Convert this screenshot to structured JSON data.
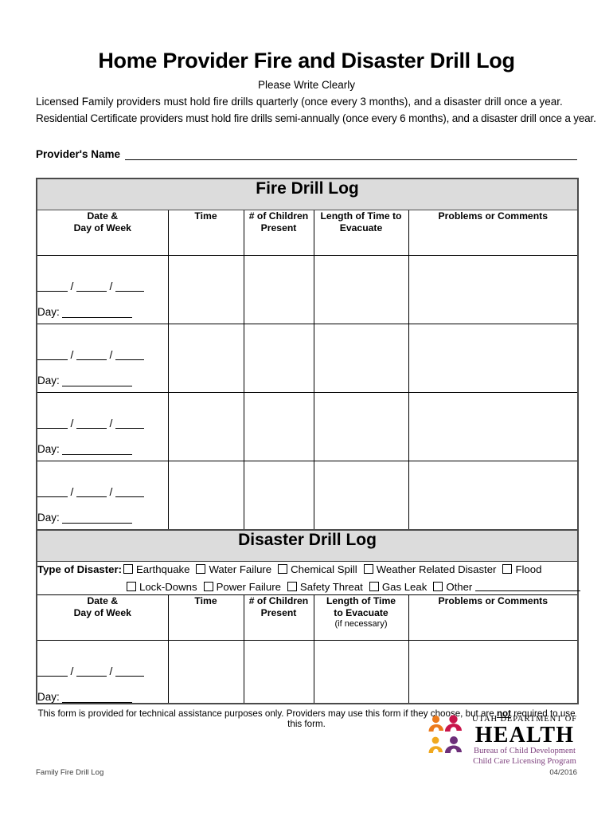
{
  "document": {
    "title": "Home Provider Fire and Disaster Drill Log",
    "subtitle": "Please Write Clearly",
    "intro_line_1": "Licensed Family providers must hold fire drills quarterly (once every 3 months), and a disaster drill once a year.",
    "intro_line_2": "Residential Certificate providers must hold fire drills semi-annually (once every 6 months), and a disaster drill once a year."
  },
  "provider": {
    "label": "Provider's Name",
    "value": ""
  },
  "fire_drill_log": {
    "band_title": "Fire Drill Log",
    "columns": [
      {
        "line1": "Date &",
        "line2": "Day of Week"
      },
      {
        "line1": "Time",
        "line2": ""
      },
      {
        "line1": "# of Children",
        "line2": "Present"
      },
      {
        "line1": "Length of Time to",
        "line2": "Evacuate"
      },
      {
        "line1": "Problems or Comments",
        "line2": ""
      }
    ],
    "day_label": "Day:",
    "date_separator": "/",
    "row_count": 4,
    "rows": [
      {
        "date": "",
        "day": "",
        "time": "",
        "children": "",
        "length": "",
        "comments": ""
      },
      {
        "date": "",
        "day": "",
        "time": "",
        "children": "",
        "length": "",
        "comments": ""
      },
      {
        "date": "",
        "day": "",
        "time": "",
        "children": "",
        "length": "",
        "comments": ""
      },
      {
        "date": "",
        "day": "",
        "time": "",
        "children": "",
        "length": "",
        "comments": ""
      }
    ]
  },
  "disaster_drill_log": {
    "band_title": "Disaster Drill Log",
    "type_label": "Type of Disaster:",
    "type_options_row1": [
      "Earthquake",
      "Water Failure",
      "Chemical Spill",
      "Weather Related Disaster",
      "Flood"
    ],
    "type_options_row2": [
      "Lock-Downs",
      "Power Failure",
      "Safety Threat",
      "Gas Leak",
      "Other"
    ],
    "other_value": "",
    "columns": [
      {
        "line1": "Date &",
        "line2": "Day of Week",
        "note": ""
      },
      {
        "line1": "Time",
        "line2": "",
        "note": ""
      },
      {
        "line1": "# of Children",
        "line2": "Present",
        "note": ""
      },
      {
        "line1": "Length of Time",
        "line2": "to Evacuate",
        "note": "(if necessary)"
      },
      {
        "line1": "Problems or Comments",
        "line2": "",
        "note": ""
      }
    ],
    "day_label": "Day:",
    "date_separator": "/",
    "row_count": 1,
    "rows": [
      {
        "date": "",
        "day": "",
        "time": "",
        "children": "",
        "length": "",
        "comments": ""
      }
    ]
  },
  "disclaimer": {
    "part1": "This form is provided for technical assistance purposes only.  Providers may use this form if they choose, but are ",
    "emphasis": "not",
    "part2": " required to use this form."
  },
  "logo": {
    "line1": "UTAH DEPARTMENT OF",
    "line2": "HEALTH",
    "line3": "Bureau of Child Development",
    "line4": "Child Care Licensing Program",
    "colors": {
      "figure_orange": "#ec7a1c",
      "figure_crimson": "#c8154b",
      "figure_gold": "#f0a81e",
      "figure_purple": "#6d2f7a",
      "text_purple": "#7d3f7d"
    }
  },
  "footer": {
    "left": "Family Fire Drill Log",
    "right": "04/2016"
  },
  "colors": {
    "band_gray": "#dcdcdc",
    "border_dark": "#4a4a4a",
    "text": "#000000"
  }
}
